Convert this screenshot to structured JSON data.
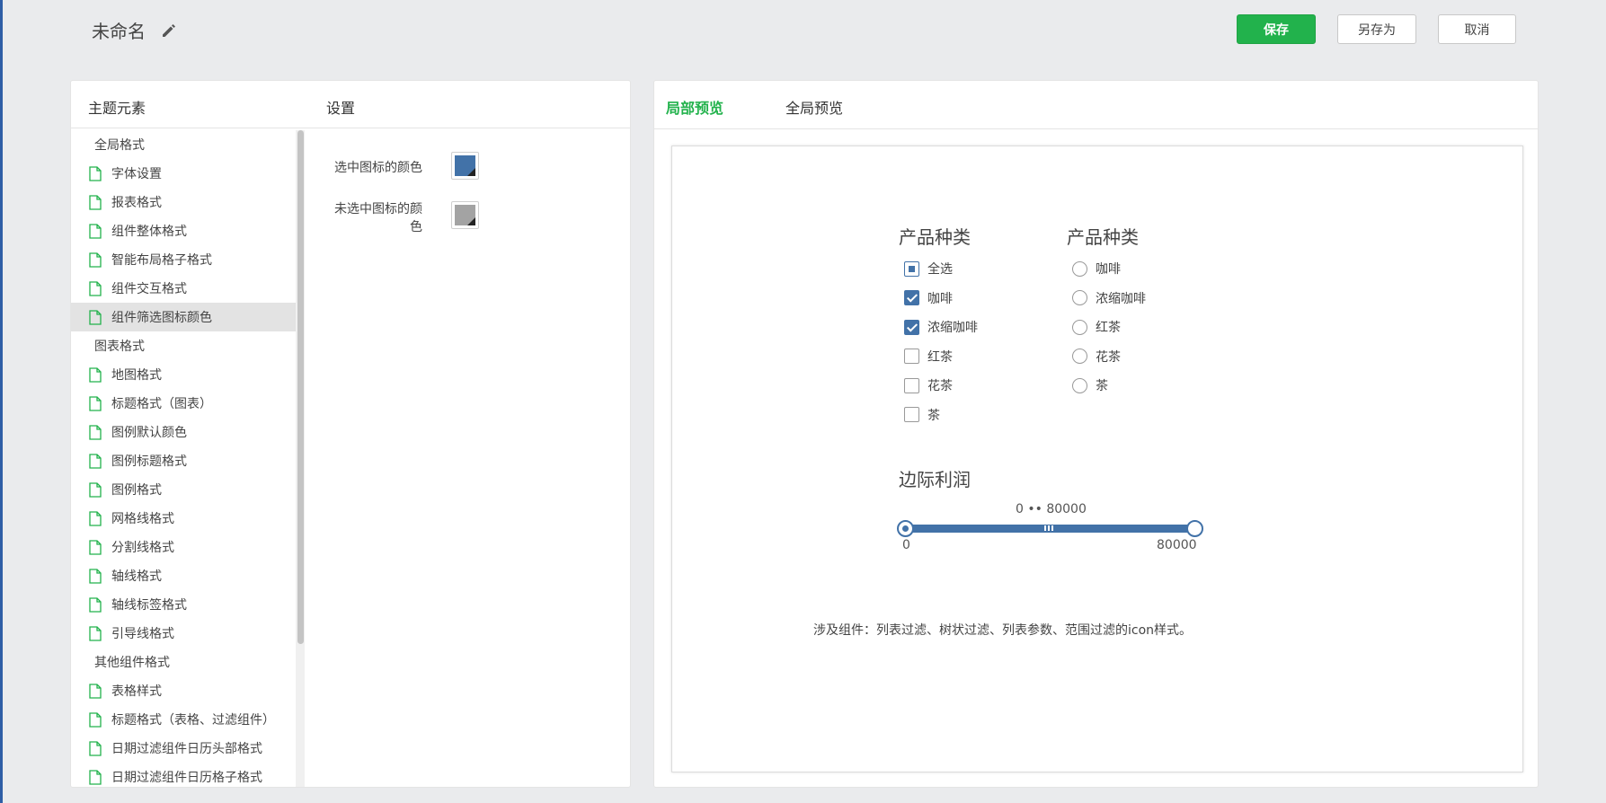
{
  "header": {
    "title": "未命名",
    "save_label": "保存",
    "saveas_label": "另存为",
    "cancel_label": "取消"
  },
  "left_panel": {
    "elements_heading": "主题元素",
    "settings_heading": "设置",
    "tree": [
      {
        "type": "group",
        "label": "全局格式"
      },
      {
        "type": "item",
        "label": "字体设置"
      },
      {
        "type": "item",
        "label": "报表格式"
      },
      {
        "type": "item",
        "label": "组件整体格式"
      },
      {
        "type": "item",
        "label": "智能布局格子格式"
      },
      {
        "type": "item",
        "label": "组件交互格式"
      },
      {
        "type": "item",
        "label": "组件筛选图标颜色",
        "selected": true
      },
      {
        "type": "group",
        "label": "图表格式"
      },
      {
        "type": "item",
        "label": "地图格式"
      },
      {
        "type": "item",
        "label": "标题格式（图表）"
      },
      {
        "type": "item",
        "label": "图例默认颜色"
      },
      {
        "type": "item",
        "label": "图例标题格式"
      },
      {
        "type": "item",
        "label": "图例格式"
      },
      {
        "type": "item",
        "label": "网格线格式"
      },
      {
        "type": "item",
        "label": "分割线格式"
      },
      {
        "type": "item",
        "label": "轴线格式"
      },
      {
        "type": "item",
        "label": "轴线标签格式"
      },
      {
        "type": "item",
        "label": "引导线格式"
      },
      {
        "type": "group",
        "label": "其他组件格式"
      },
      {
        "type": "item",
        "label": "表格样式"
      },
      {
        "type": "item",
        "label": "标题格式（表格、过滤组件）"
      },
      {
        "type": "item",
        "label": "日期过滤组件日历头部格式"
      },
      {
        "type": "item",
        "label": "日期过滤组件日历格子格式"
      }
    ],
    "settings": {
      "selected_icon_color_label": "选中图标的颜色",
      "selected_icon_color": "#4272a8",
      "unselected_icon_color_label_line1": "未选中图标的颜",
      "unselected_icon_color_label_line2": "色",
      "unselected_icon_color": "#a3a3a3"
    }
  },
  "right_panel": {
    "tab_local": "局部预览",
    "tab_global": "全局预览",
    "preview": {
      "checkbox_filter": {
        "title": "产品种类",
        "options": [
          {
            "label": "全选",
            "state": "partial"
          },
          {
            "label": "咖啡",
            "state": "checked"
          },
          {
            "label": "浓缩咖啡",
            "state": "checked"
          },
          {
            "label": "红茶",
            "state": "unchecked"
          },
          {
            "label": "花茶",
            "state": "unchecked"
          },
          {
            "label": "茶",
            "state": "unchecked"
          }
        ]
      },
      "radio_filter": {
        "title": "产品种类",
        "options": [
          {
            "label": "咖啡"
          },
          {
            "label": "浓缩咖啡"
          },
          {
            "label": "红茶"
          },
          {
            "label": "花茶"
          },
          {
            "label": "茶"
          }
        ]
      },
      "range_filter": {
        "title": "边际利润",
        "range_text": "0 •• 80000",
        "min_label": "0",
        "max_label": "80000",
        "min": 0,
        "max": 80000,
        "low": 0,
        "high": 80000
      },
      "note": "涉及组件：列表过滤、树状过滤、列表参数、范围过滤的icon样式。"
    }
  },
  "colors": {
    "accent_green": "#22b24c",
    "filter_blue": "#4272a8"
  }
}
